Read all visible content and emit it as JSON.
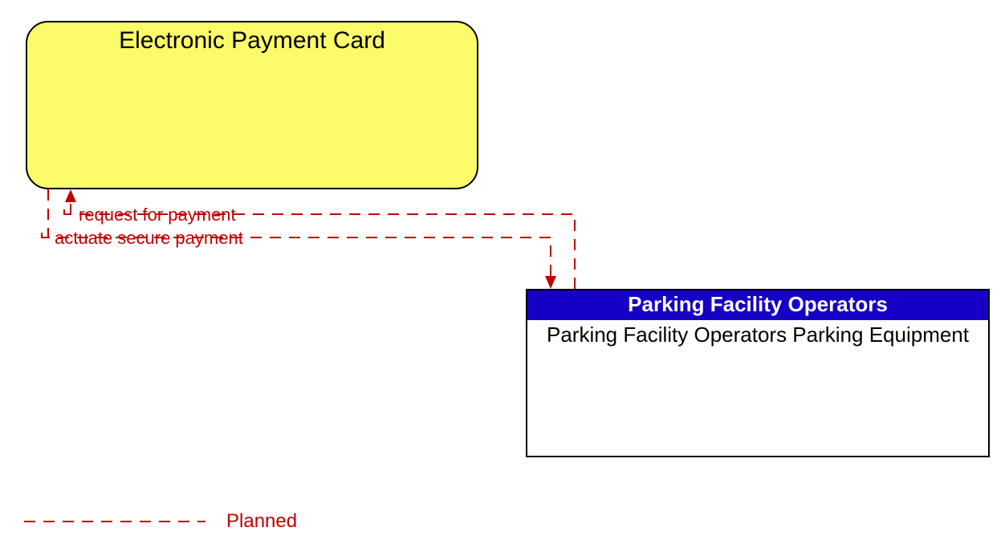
{
  "nodes": {
    "epc": {
      "title": "Electronic Payment Card"
    },
    "pfo": {
      "header": "Parking Facility Operators",
      "body": "Parking Facility Operators Parking Equipment"
    }
  },
  "flows": {
    "to_epc": "request for payment",
    "to_pfo": "actuate secure payment"
  },
  "legend": {
    "planned": "Planned"
  },
  "colors": {
    "planned_line": "#c00000",
    "epc_fill": "#fcfc6a",
    "pfo_header": "#1500c4"
  }
}
